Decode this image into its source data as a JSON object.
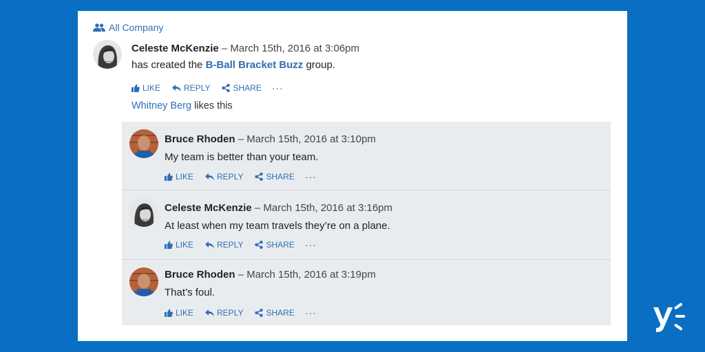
{
  "group": {
    "label": "All Company"
  },
  "post": {
    "author": "Celeste McKenzie",
    "separator": "–",
    "timestamp": "March 15th, 2016 at 3:06pm",
    "body_prefix": "has created the",
    "group_link": "B-Ball Bracket Buzz",
    "body_suffix": "group."
  },
  "actions": {
    "like": "LIKE",
    "reply": "REPLY",
    "share": "SHARE",
    "more": "···"
  },
  "likes": {
    "name": "Whitney Berg",
    "text": "likes this"
  },
  "replies": [
    {
      "author": "Bruce Rhoden",
      "separator": "–",
      "timestamp": "March 15th, 2016 at 3:10pm",
      "body": "My team is better than your team."
    },
    {
      "author": "Celeste McKenzie",
      "separator": "–",
      "timestamp": "March 15th, 2016 at 3:16pm",
      "body": "At least when my team travels they’re on a plane."
    },
    {
      "author": "Bruce Rhoden",
      "separator": "–",
      "timestamp": "March 15th, 2016 at 3:19pm",
      "body": "That’s foul."
    }
  ],
  "colors": {
    "background": "#0a6fc2",
    "link": "#2f6fb3",
    "thread_bg": "#e9ecef"
  },
  "icons": [
    "people-icon",
    "thumbs-up-icon",
    "reply-icon",
    "share-icon",
    "yammer-logo"
  ]
}
